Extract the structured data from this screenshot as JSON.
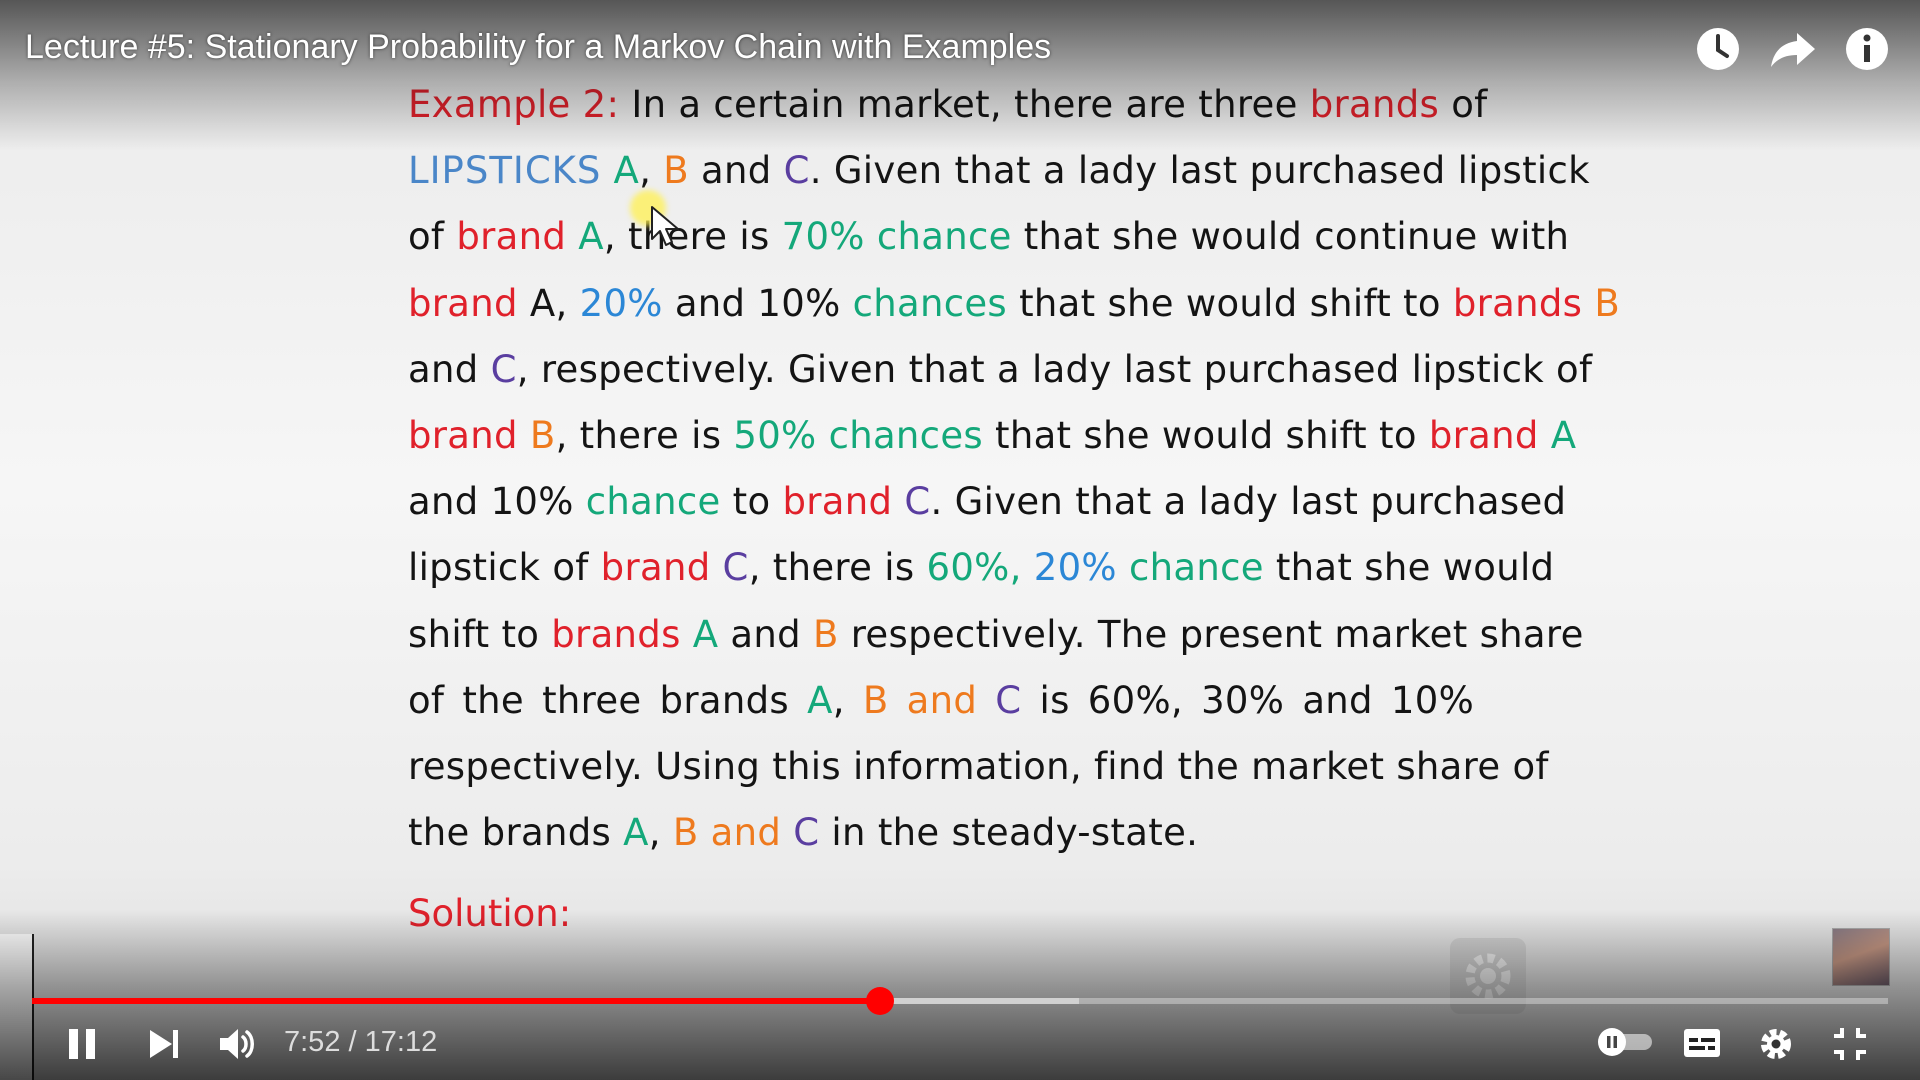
{
  "video": {
    "title": "Lecture #5: Stationary Probability for a Markov Chain with Examples",
    "current_time": "7:52",
    "duration": "17:12",
    "time_separator": "/",
    "progress_fraction": 0.457,
    "buffered_fraction": 0.564
  },
  "slide": {
    "lines": [
      [
        "Example 2:",
        "In a certain market, there are three",
        "brands",
        "of"
      ],
      [
        "LIPSTICKS",
        "A",
        ",",
        "B",
        "and",
        "C",
        ". Given that a lady last purchased lipstick"
      ],
      [
        "of",
        "brand",
        "A",
        ", there is",
        "70%",
        "chance",
        "that she would continue with"
      ],
      [
        "brand",
        "A,",
        "20%",
        "and 10%",
        "chances",
        "that she would shift to",
        "brands",
        "B"
      ],
      [
        "and",
        "C",
        ", respectively.  Given that a lady last purchased lipstick of"
      ],
      [
        "brand",
        "B",
        ", there is",
        "50%",
        "chances",
        "that she would shift to",
        "brand",
        "A"
      ],
      [
        "and 10%",
        "chance",
        "to",
        "brand",
        "C",
        ". Given that a lady last purchased"
      ],
      [
        "lipstick of",
        "brand",
        "C",
        ", there is",
        "60%,",
        "20%",
        "chance",
        "that she would"
      ],
      [
        "shift to",
        "brands",
        "A",
        "and",
        "B",
        "respectively. The present market share"
      ],
      [
        "of the three brands",
        "A",
        ",",
        "B",
        "and",
        "C",
        "is 60%, 30% and 10%"
      ],
      [
        "respectively. Using this information, find the market share of"
      ],
      [
        "the brands",
        "A",
        ",",
        "B",
        "and",
        "C",
        "in the steady-state."
      ]
    ],
    "solution_label": "Solution:"
  },
  "icons": {
    "watch_later": "clock-icon",
    "share": "share-arrow-icon",
    "info": "info-icon",
    "play_pause": "pause-icon",
    "next": "next-icon",
    "volume": "volume-icon",
    "autoplay": "autoplay-toggle-icon",
    "captions": "captions-icon",
    "settings": "gear-icon",
    "exit_fullscreen": "exit-fullscreen-icon"
  },
  "colors": {
    "progress": "#ff0000",
    "text_red": "#e0212b",
    "text_green": "#14a87a",
    "text_blue": "#2b87d6",
    "text_orange": "#ee7a1e",
    "text_purple": "#5a3ea0"
  }
}
